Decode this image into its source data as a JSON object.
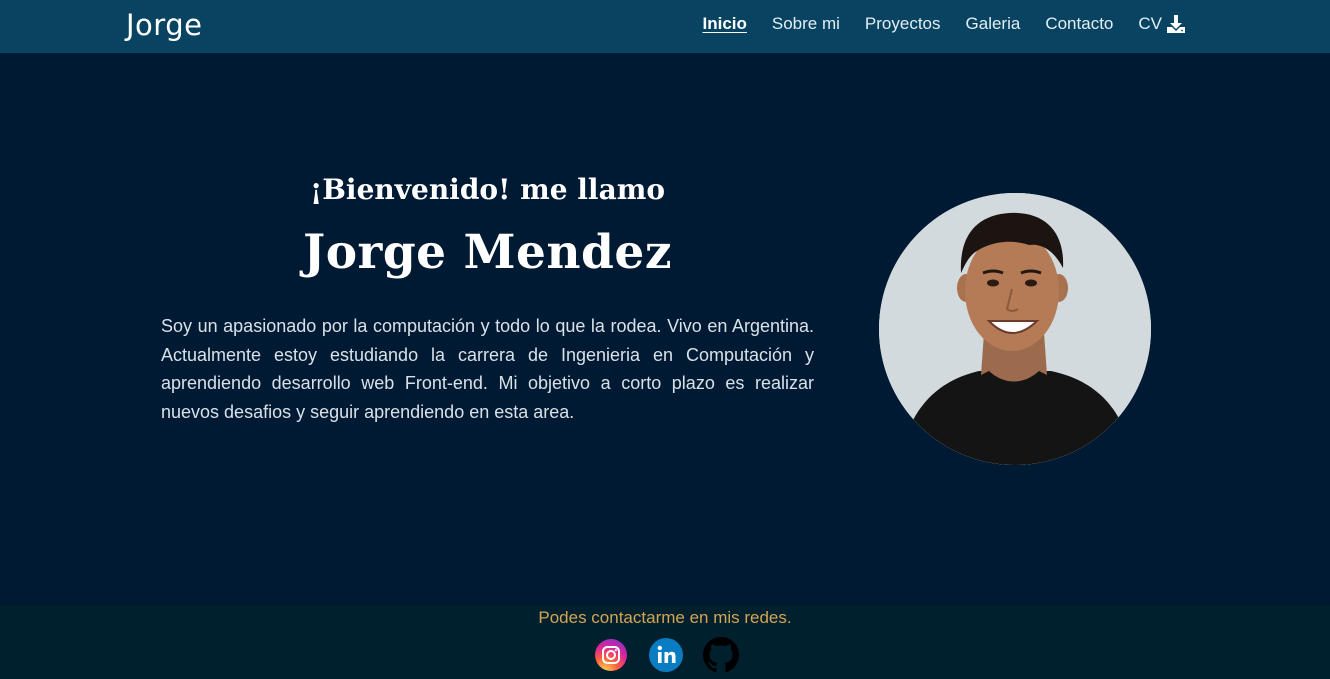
{
  "navbar": {
    "brand": "Jorge",
    "links": [
      {
        "label": "Inicio",
        "active": true
      },
      {
        "label": "Sobre mi"
      },
      {
        "label": "Proyectos"
      },
      {
        "label": "Galeria"
      },
      {
        "label": "Contacto"
      },
      {
        "label": "CV",
        "icon": "download-icon"
      }
    ]
  },
  "hero": {
    "greeting": "¡Bienvenido! me llamo",
    "name": "Jorge Mendez",
    "bio": "Soy un apasionado por la computación y todo lo que la rodea. Vivo en Argentina. Actualmente estoy estudiando la carrera de Ingenieria en Computación y aprendiendo desarrollo web Front-end. Mi objetivo a corto plazo es realizar nuevos desafios y seguir aprendiendo en esta area.",
    "photo": "profile-photo"
  },
  "footer": {
    "text": "Podes contactarme en mis redes.",
    "socials": [
      {
        "icon": "instagram-icon"
      },
      {
        "icon": "linkedin-icon"
      },
      {
        "icon": "github-icon"
      }
    ]
  },
  "colors": {
    "navbar_bg": "#084462",
    "page_bg": "#001a33",
    "footer_bg": "#00202e",
    "footer_text": "#d4a553"
  }
}
